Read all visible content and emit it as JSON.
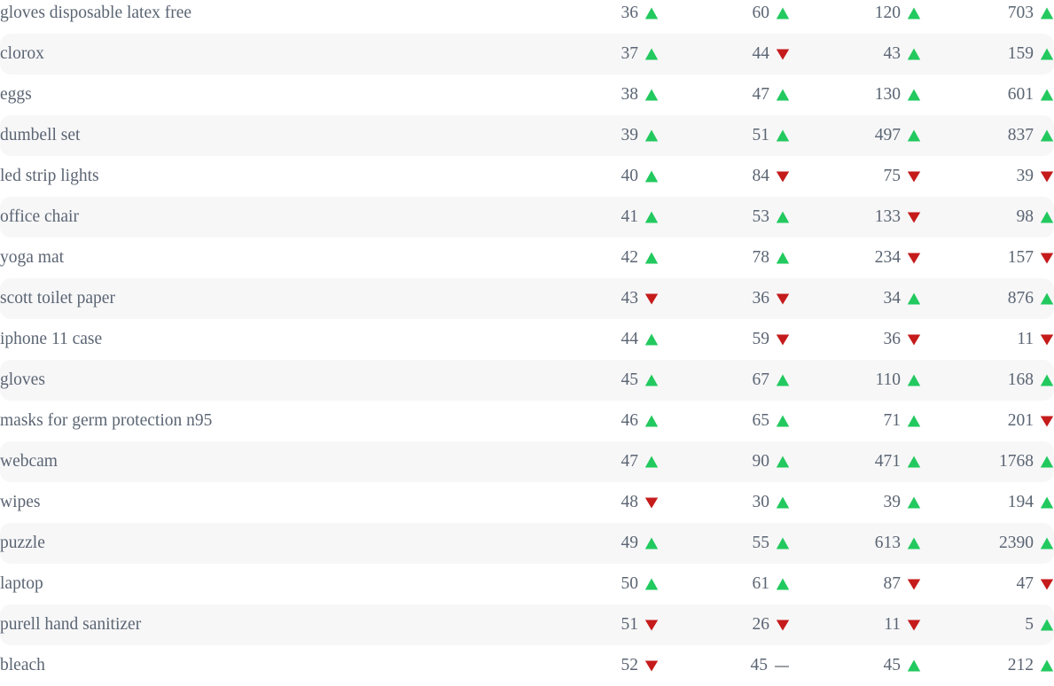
{
  "colors": {
    "text": "#5b6573",
    "row_stripe": "#f7f7f8",
    "row_base": "#ffffff",
    "trend_up": "#22c95e",
    "trend_down": "#c51b1b",
    "trend_flat": "#9aa0a6"
  },
  "icons": {
    "up": "triangle-up-icon",
    "down": "triangle-down-icon",
    "flat": "dash-flat-icon"
  },
  "table": {
    "columns": [
      {
        "key": "term",
        "label": ""
      },
      {
        "key": "metric_1",
        "label": ""
      },
      {
        "key": "metric_2",
        "label": ""
      },
      {
        "key": "metric_3",
        "label": ""
      },
      {
        "key": "metric_4",
        "label": ""
      }
    ],
    "rows": [
      {
        "term": "gloves disposable latex free",
        "metric_1": "36",
        "trend_1": "up",
        "metric_2": "60",
        "trend_2": "up",
        "metric_3": "120",
        "trend_3": "up",
        "metric_4": "703",
        "trend_4": "up"
      },
      {
        "term": "clorox",
        "metric_1": "37",
        "trend_1": "up",
        "metric_2": "44",
        "trend_2": "down",
        "metric_3": "43",
        "trend_3": "up",
        "metric_4": "159",
        "trend_4": "up"
      },
      {
        "term": "eggs",
        "metric_1": "38",
        "trend_1": "up",
        "metric_2": "47",
        "trend_2": "up",
        "metric_3": "130",
        "trend_3": "up",
        "metric_4": "601",
        "trend_4": "up"
      },
      {
        "term": "dumbell set",
        "metric_1": "39",
        "trend_1": "up",
        "metric_2": "51",
        "trend_2": "up",
        "metric_3": "497",
        "trend_3": "up",
        "metric_4": "837",
        "trend_4": "up"
      },
      {
        "term": "led strip lights",
        "metric_1": "40",
        "trend_1": "up",
        "metric_2": "84",
        "trend_2": "down",
        "metric_3": "75",
        "trend_3": "down",
        "metric_4": "39",
        "trend_4": "down"
      },
      {
        "term": "office chair",
        "metric_1": "41",
        "trend_1": "up",
        "metric_2": "53",
        "trend_2": "up",
        "metric_3": "133",
        "trend_3": "down",
        "metric_4": "98",
        "trend_4": "up"
      },
      {
        "term": "yoga mat",
        "metric_1": "42",
        "trend_1": "up",
        "metric_2": "78",
        "trend_2": "up",
        "metric_3": "234",
        "trend_3": "down",
        "metric_4": "157",
        "trend_4": "down"
      },
      {
        "term": "scott toilet paper",
        "metric_1": "43",
        "trend_1": "down",
        "metric_2": "36",
        "trend_2": "down",
        "metric_3": "34",
        "trend_3": "up",
        "metric_4": "876",
        "trend_4": "up"
      },
      {
        "term": "iphone 11 case",
        "metric_1": "44",
        "trend_1": "up",
        "metric_2": "59",
        "trend_2": "down",
        "metric_3": "36",
        "trend_3": "down",
        "metric_4": "11",
        "trend_4": "down"
      },
      {
        "term": "gloves",
        "metric_1": "45",
        "trend_1": "up",
        "metric_2": "67",
        "trend_2": "up",
        "metric_3": "110",
        "trend_3": "up",
        "metric_4": "168",
        "trend_4": "up"
      },
      {
        "term": "masks for germ protection n95",
        "metric_1": "46",
        "trend_1": "up",
        "metric_2": "65",
        "trend_2": "up",
        "metric_3": "71",
        "trend_3": "up",
        "metric_4": "201",
        "trend_4": "down"
      },
      {
        "term": "webcam",
        "metric_1": "47",
        "trend_1": "up",
        "metric_2": "90",
        "trend_2": "up",
        "metric_3": "471",
        "trend_3": "up",
        "metric_4": "1768",
        "trend_4": "up"
      },
      {
        "term": "wipes",
        "metric_1": "48",
        "trend_1": "down",
        "metric_2": "30",
        "trend_2": "up",
        "metric_3": "39",
        "trend_3": "up",
        "metric_4": "194",
        "trend_4": "up"
      },
      {
        "term": "puzzle",
        "metric_1": "49",
        "trend_1": "up",
        "metric_2": "55",
        "trend_2": "up",
        "metric_3": "613",
        "trend_3": "up",
        "metric_4": "2390",
        "trend_4": "up"
      },
      {
        "term": "laptop",
        "metric_1": "50",
        "trend_1": "up",
        "metric_2": "61",
        "trend_2": "up",
        "metric_3": "87",
        "trend_3": "down",
        "metric_4": "47",
        "trend_4": "down"
      },
      {
        "term": "purell hand sanitizer",
        "metric_1": "51",
        "trend_1": "down",
        "metric_2": "26",
        "trend_2": "down",
        "metric_3": "11",
        "trend_3": "down",
        "metric_4": "5",
        "trend_4": "up"
      },
      {
        "term": "bleach",
        "metric_1": "52",
        "trend_1": "down",
        "metric_2": "45",
        "trend_2": "flat",
        "metric_3": "45",
        "trend_3": "up",
        "metric_4": "212",
        "trend_4": "up"
      }
    ]
  }
}
